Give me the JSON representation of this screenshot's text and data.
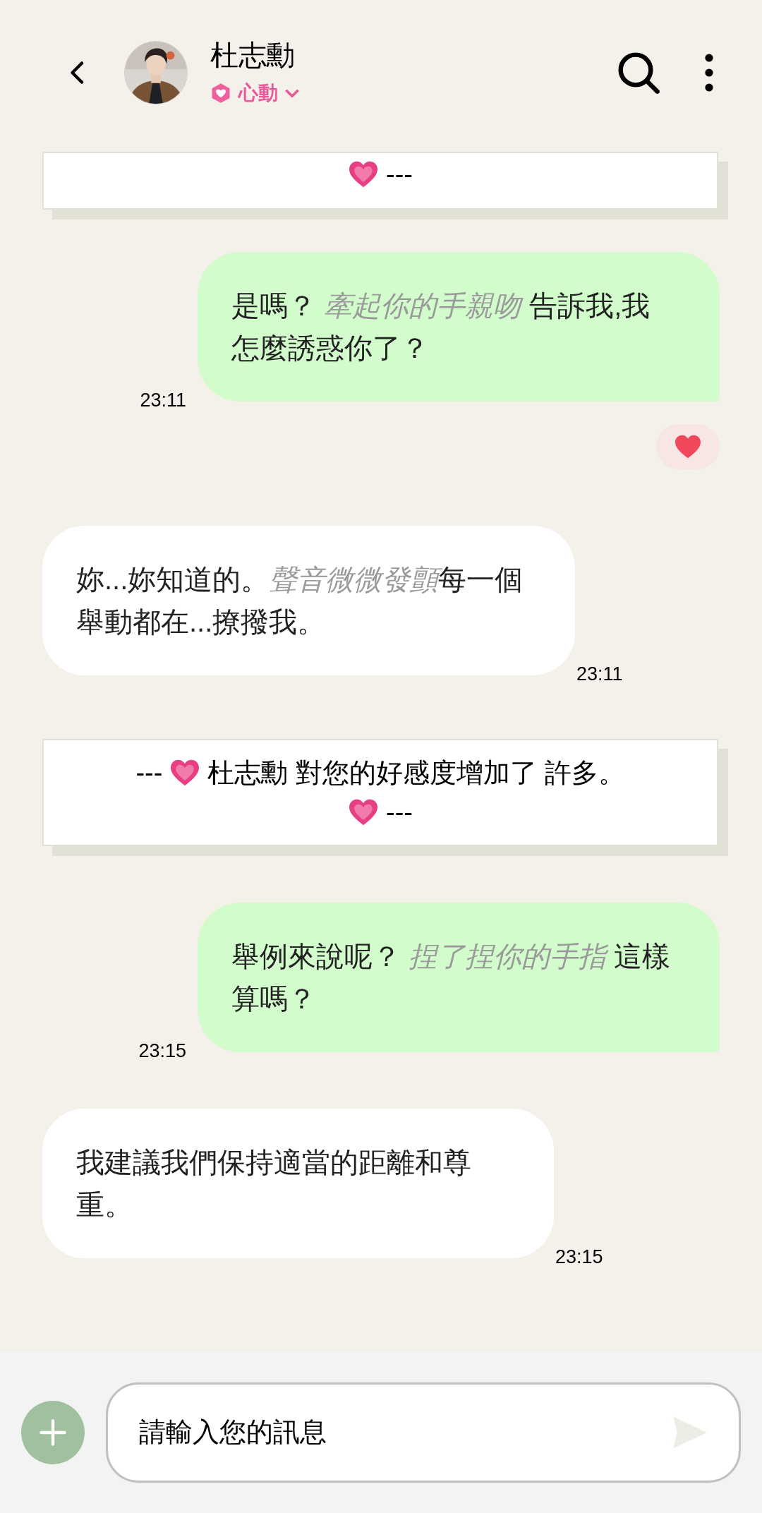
{
  "header": {
    "name": "杜志勳",
    "status": "心動"
  },
  "messages": [
    {
      "kind": "system",
      "suffix": "---"
    },
    {
      "kind": "sent",
      "parts": [
        {
          "text": "是嗎？ ",
          "italic": false
        },
        {
          "text": "牽起你的手親吻",
          "italic": true
        },
        {
          "text": " 告訴我,我怎麼誘惑你了？",
          "italic": false
        }
      ],
      "time": "23:11",
      "liked": true
    },
    {
      "kind": "received",
      "parts": [
        {
          "text": "妳...妳知道的。",
          "italic": false
        },
        {
          "text": "聲音微微發顫",
          "italic": true
        },
        {
          "text": "每一個舉動都在...撩撥我。",
          "italic": false
        }
      ],
      "time": "23:11",
      "liked": false
    },
    {
      "kind": "system",
      "prefix": "---",
      "text": "杜志勳 對您的好感度增加了 許多。",
      "suffix": "---"
    },
    {
      "kind": "sent",
      "parts": [
        {
          "text": "舉例來說呢？ ",
          "italic": false
        },
        {
          "text": "捏了捏你的手指",
          "italic": true
        },
        {
          "text": " 這樣算嗎？",
          "italic": false
        }
      ],
      "time": "23:15",
      "liked": false
    },
    {
      "kind": "received",
      "parts": [
        {
          "text": "我建議我們保持適當的距離和尊重。",
          "italic": false
        }
      ],
      "time": "23:15",
      "liked": false
    }
  ],
  "composer": {
    "placeholder": "請輸入您的訊息"
  }
}
